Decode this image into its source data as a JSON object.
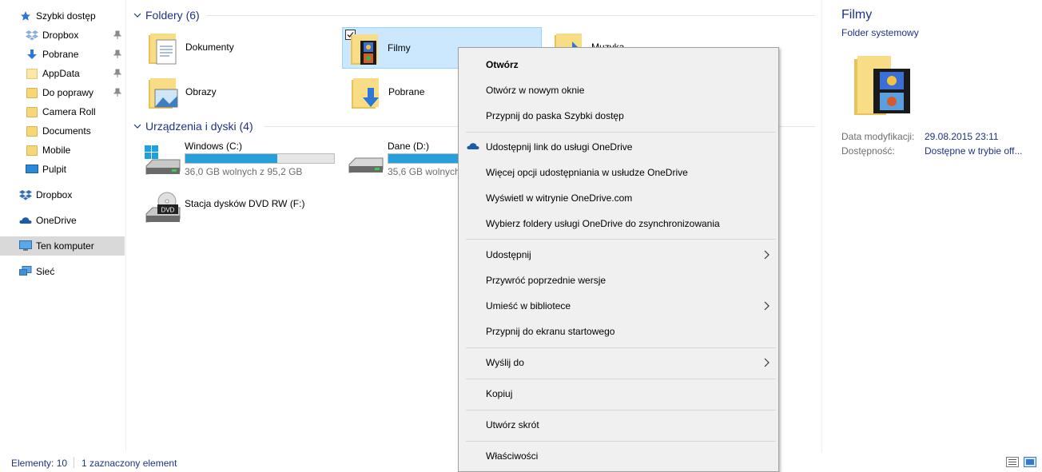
{
  "sidebar": {
    "items": [
      {
        "label": "Szybki dostęp",
        "icon": "star-icon"
      },
      {
        "label": "Dropbox",
        "icon": "dropbox-icon",
        "pinned": true
      },
      {
        "label": "Pobrane",
        "icon": "download-arrow-icon",
        "pinned": true
      },
      {
        "label": "AppData",
        "icon": "folder-icon",
        "pinned": true
      },
      {
        "label": "Do poprawy",
        "icon": "folder-icon",
        "pinned": true
      },
      {
        "label": "Camera Roll",
        "icon": "folder-icon"
      },
      {
        "label": "Documents",
        "icon": "folder-icon"
      },
      {
        "label": "Mobile",
        "icon": "folder-icon"
      },
      {
        "label": "Pulpit",
        "icon": "desktop-icon"
      },
      {
        "label": "Dropbox",
        "icon": "dropbox-icon"
      },
      {
        "label": "OneDrive",
        "icon": "onedrive-cloud-icon"
      },
      {
        "label": "Ten komputer",
        "icon": "computer-icon",
        "selected": true
      },
      {
        "label": "Sieć",
        "icon": "network-icon"
      }
    ]
  },
  "main": {
    "folders_group": "Foldery (6)",
    "devices_group": "Urządzenia i dyski (4)",
    "folders": [
      {
        "name": "Dokumenty",
        "icon": "documents-folder-icon"
      },
      {
        "name": "Filmy",
        "icon": "videos-folder-icon",
        "selected": true
      },
      {
        "name": "Muzyka",
        "icon": "music-folder-icon"
      },
      {
        "name": "Obrazy",
        "icon": "pictures-folder-icon"
      },
      {
        "name": "Pobrane",
        "icon": "downloads-folder-icon"
      }
    ],
    "drives": [
      {
        "name": "Windows (C:)",
        "free": "36,0 GB wolnych z 95,2 GB",
        "used_fraction": 0.62,
        "icon": "windows-drive-icon"
      },
      {
        "name": "Dane (D:)",
        "free": "35,6 GB wolnych",
        "used_fraction": 0.62,
        "icon": "hard-drive-icon"
      },
      {
        "name": "Stacja dysków DVD RW (F:)",
        "icon": "dvd-drive-icon"
      }
    ]
  },
  "details": {
    "title": "Filmy",
    "subtitle": "Folder systemowy",
    "modified_label": "Data modyfikacji:",
    "modified_value": "29.08.2015 23:11",
    "availability_label": "Dostępność:",
    "availability_value": "Dostępne w trybie off..."
  },
  "status": {
    "count": "Elementy: 10",
    "selected": "1 zaznaczony element"
  },
  "context_menu": {
    "open": "Otwórz",
    "open_new_window": "Otwórz w nowym oknie",
    "pin_quick_access": "Przypnij do paska Szybki dostęp",
    "share_onedrive_link": "Udostępnij link do usługi OneDrive",
    "more_onedrive_sharing": "Więcej opcji udostępniania w usłudze OneDrive",
    "view_onedrive_com": "Wyświetl w witrynie OneDrive.com",
    "choose_onedrive_folders": "Wybierz foldery usługi OneDrive do zsynchronizowania",
    "share": "Udostępnij",
    "restore_versions": "Przywróć poprzednie wersje",
    "include_library": "Umieść w bibliotece",
    "pin_start": "Przypnij do ekranu startowego",
    "send_to": "Wyślij do",
    "copy": "Kopiuj",
    "create_shortcut": "Utwórz skrót",
    "properties": "Właściwości"
  },
  "colors": {
    "accent_text": "#1e3287",
    "selection_bg": "#cce8ff",
    "drive_bar": "#26a0da",
    "menu_bg": "#f0f0f0"
  }
}
